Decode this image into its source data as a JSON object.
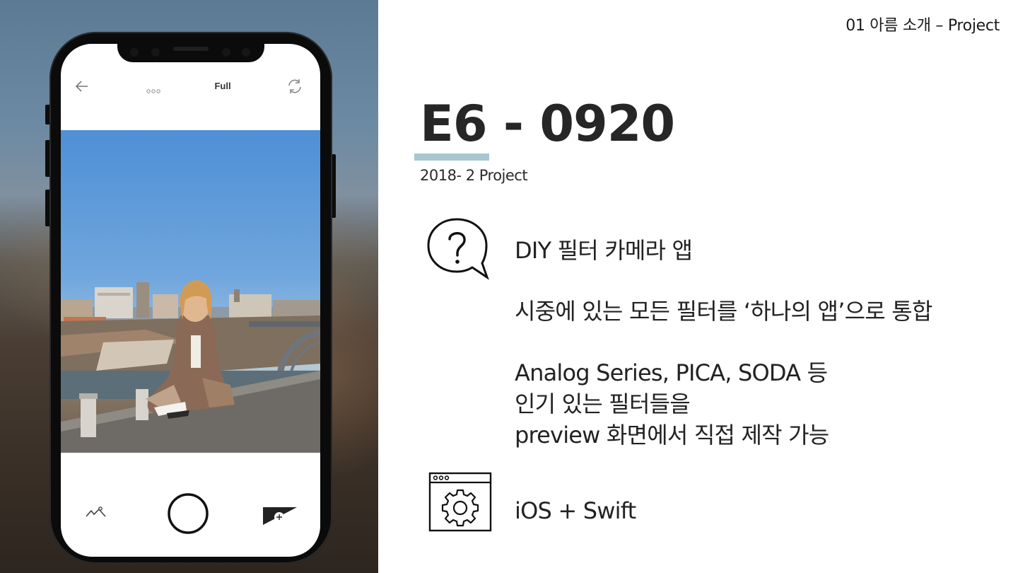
{
  "slide": {
    "breadcrumb": "01 아름 소개 – Project",
    "title": "E6 - 0920",
    "subtitle": "2018- 2 Project",
    "accent_color": "#a6c7d1"
  },
  "phone": {
    "header": {
      "back_icon": "arrow-left-icon",
      "more_icon": "dots-icon",
      "mode_label": "Full",
      "refresh_icon": "refresh-icon"
    },
    "footer": {
      "gallery_icon": "gallery-icon",
      "shutter_icon": "shutter-button",
      "filter_icon": "filter-add-icon"
    }
  },
  "features": {
    "question_icon": "question-bubble-icon",
    "line1": "DIY 필터 카메라 앱",
    "line2": "시중에 있는 모든 필터를 ‘하나의 앱’으로 통합",
    "line3": "Analog Series, PICA, SODA 등",
    "line4": "인기 있는 필터들을",
    "line5": "preview 화면에서 직접 제작 가능",
    "settings_icon": "settings-window-icon",
    "tech": "iOS + Swift"
  }
}
